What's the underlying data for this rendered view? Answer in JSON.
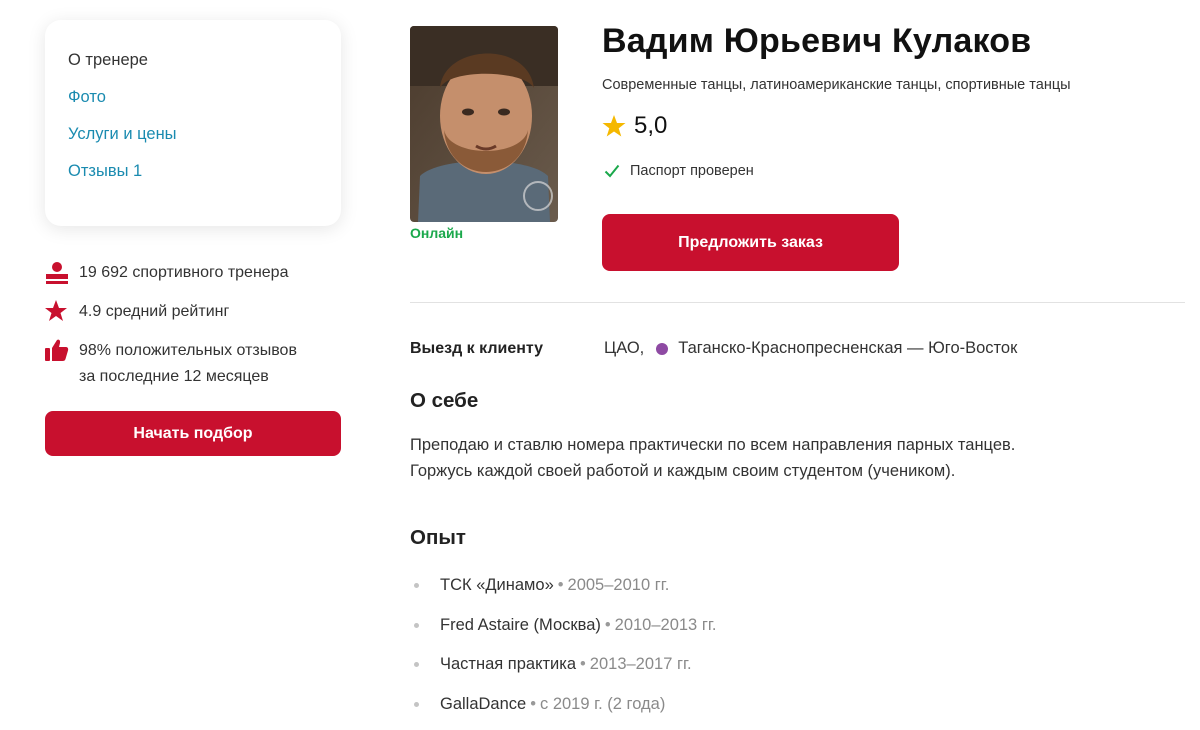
{
  "nav": {
    "items": [
      {
        "label": "О тренере",
        "current": true
      },
      {
        "label": "Фото",
        "current": false
      },
      {
        "label": "Услуги и цены",
        "current": false
      },
      {
        "label": "Отзывы 1",
        "current": false
      }
    ]
  },
  "stats": {
    "trainers": "19 692 спортивного тренера",
    "rating": "4.9 средний рейтинг",
    "reviews_line1": "98% положительных отзывов",
    "reviews_line2": "за последние 12 месяцев"
  },
  "start_button": "Начать подбор",
  "profile": {
    "name": "Вадим Юрьевич Кулаков",
    "specialties": "Современные танцы, латиноамериканские танцы, спортивные танцы",
    "rating": "5,0",
    "verified": "Паспорт проверен",
    "online": "Онлайн",
    "order_button": "Предложить заказ"
  },
  "visit": {
    "label": "Выезд к клиенту",
    "district": "ЦАО,",
    "metro_line": "Таганско-Краснопресненская — Юго-Восток",
    "metro_color": "#8e4aa3"
  },
  "about": {
    "heading": "О себе",
    "line1": "Преподаю и ставлю номера практически по всем направления парных танцев.",
    "line2": "Горжусь каждой своей работой и каждым своим студентом (учеником)."
  },
  "experience": {
    "heading": "Опыт",
    "items": [
      {
        "place": "ТСК «Динамо»",
        "years": "2005–2010 гг."
      },
      {
        "place": "Fred Astaire (Москва)",
        "years": "2010–2013 гг."
      },
      {
        "place": "Частная практика",
        "years": "2013–2017 гг."
      },
      {
        "place": "GallaDance",
        "years": "с 2019 г. (2 года)"
      }
    ]
  },
  "colors": {
    "accent": "#c8102e",
    "link": "#1a8bb0",
    "online": "#1aa84b",
    "star": "#f5b800"
  },
  "icons": {
    "trainers": "person-icon",
    "rating": "star-icon",
    "reviews": "thumbs-up-icon",
    "verified": "check-icon"
  }
}
